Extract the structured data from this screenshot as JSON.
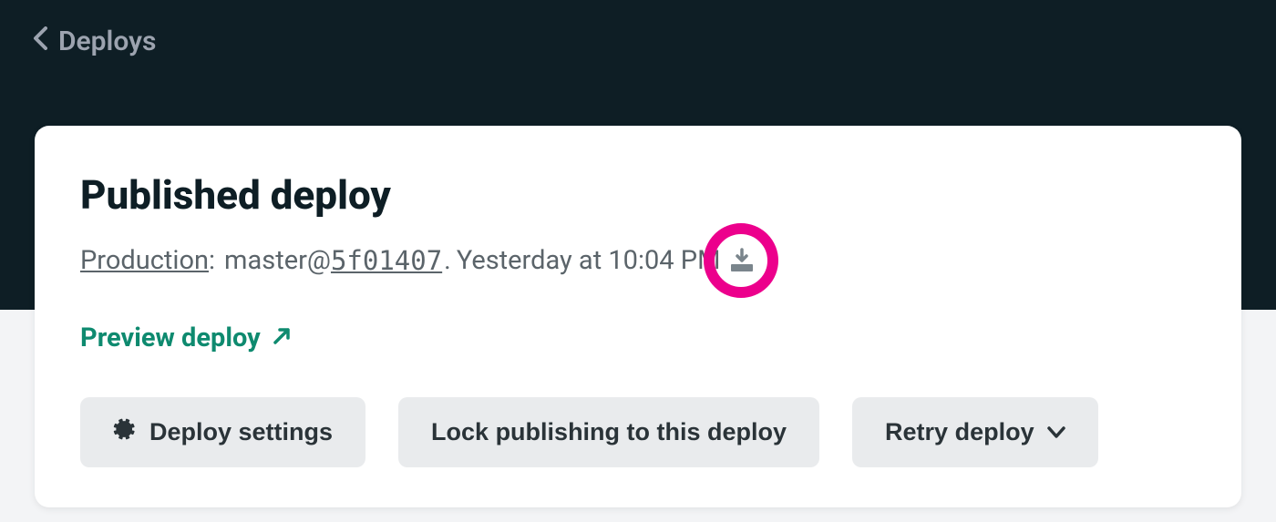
{
  "nav": {
    "back_label": "Deploys"
  },
  "card": {
    "title": "Published deploy",
    "meta": {
      "production_label": "Production",
      "branch": "master",
      "commit": "5f01407",
      "timestamp": "Yesterday at 10:04 PM"
    },
    "preview_link_label": "Preview deploy",
    "buttons": {
      "deploy_settings": "Deploy settings",
      "lock_publishing": "Lock publishing to this deploy",
      "retry_deploy": "Retry deploy"
    }
  }
}
